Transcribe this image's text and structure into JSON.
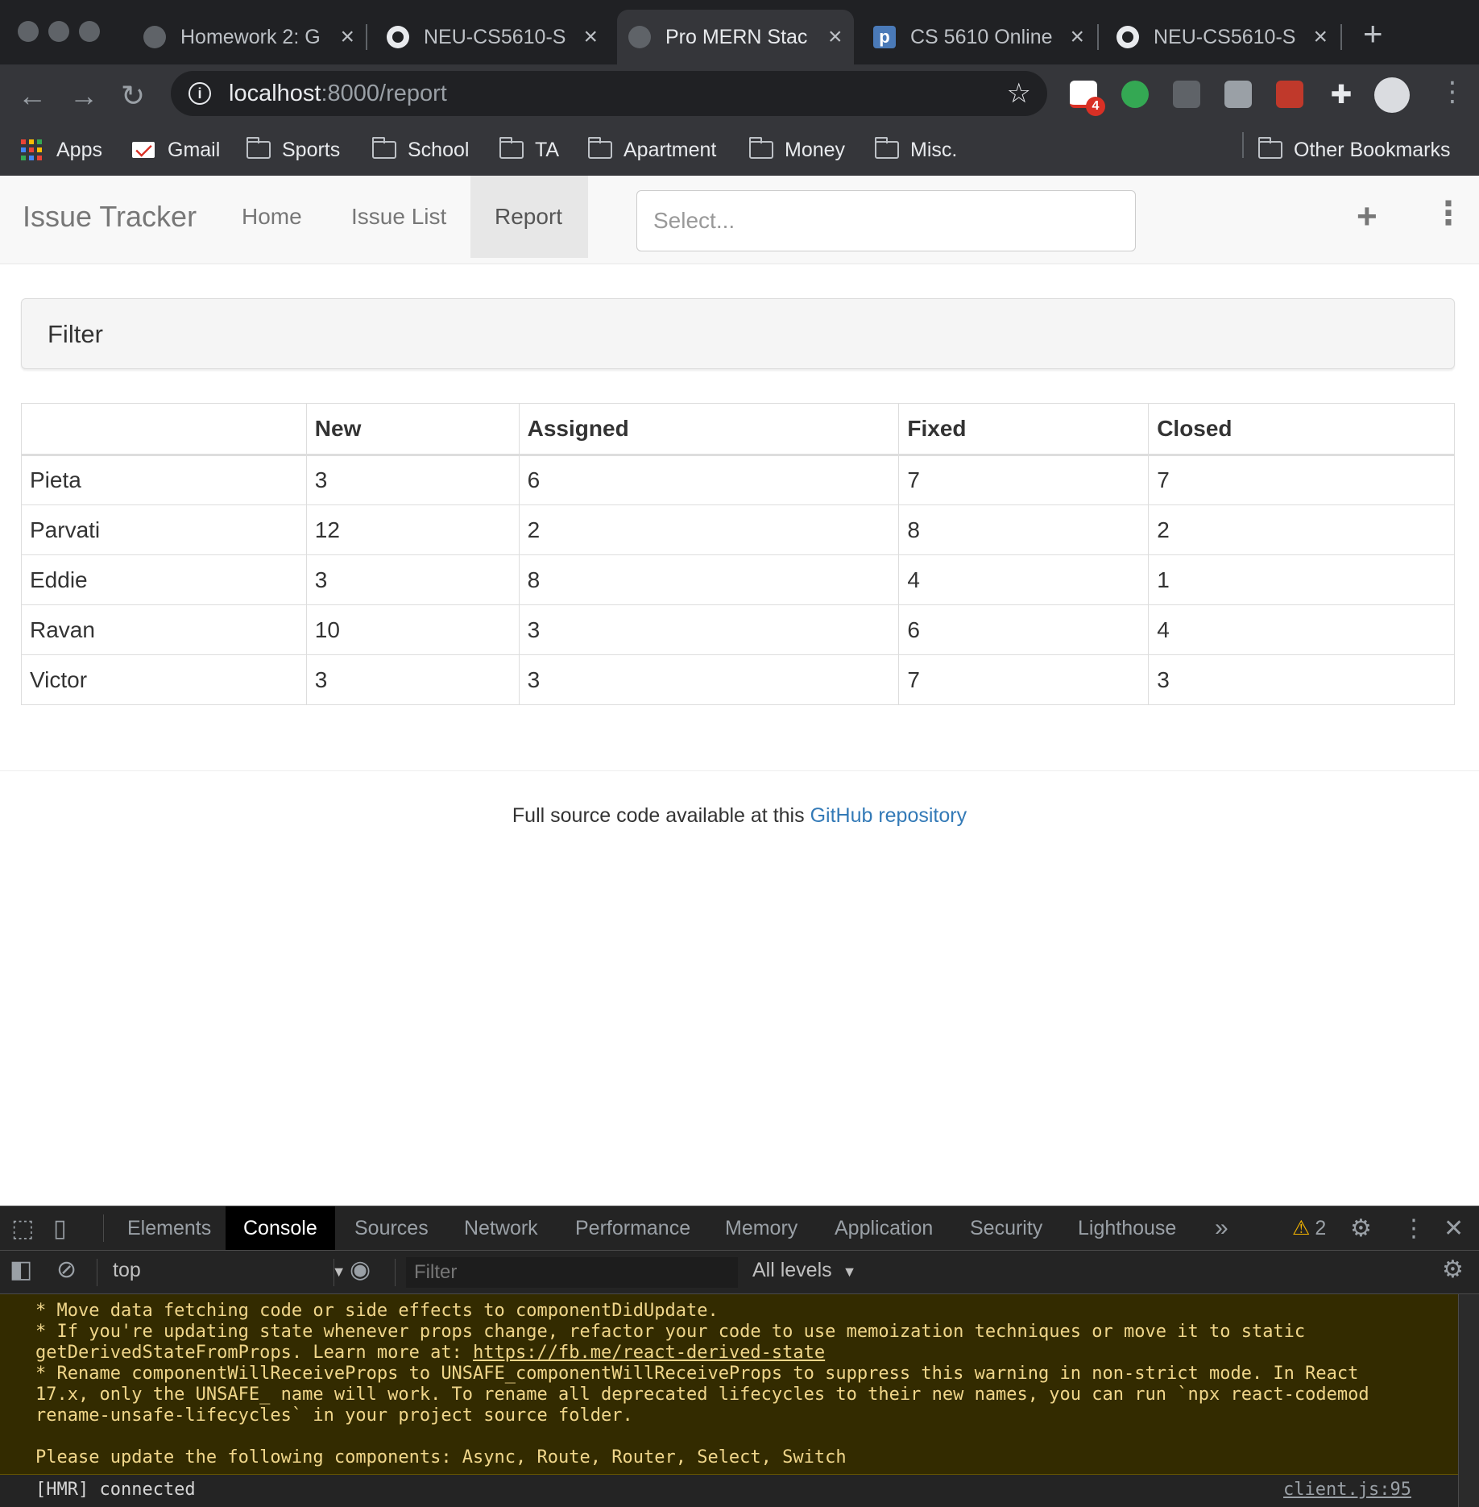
{
  "browser": {
    "tabs": [
      {
        "title": "Homework 2: G",
        "icon": "globe-icon"
      },
      {
        "title": "NEU-CS5610-S",
        "icon": "github-icon"
      },
      {
        "title": "Pro MERN Stac",
        "icon": "globe-icon",
        "active": true
      },
      {
        "title": "CS 5610 Online",
        "icon": "p-icon"
      },
      {
        "title": "NEU-CS5610-S",
        "icon": "github-icon"
      }
    ],
    "url_host": "localhost",
    "url_path": ":8000/report",
    "extension_badge": "4",
    "bookmarks": {
      "apps": "Apps",
      "gmail": "Gmail",
      "folders": [
        "Sports",
        "School",
        "TA",
        "Apartment",
        "Money",
        "Misc."
      ],
      "other": "Other Bookmarks"
    }
  },
  "app": {
    "brand": "Issue Tracker",
    "nav": {
      "home": "Home",
      "issue_list": "Issue List",
      "report": "Report"
    },
    "search_placeholder": "Select...",
    "filter_title": "Filter",
    "table": {
      "headers": [
        "",
        "New",
        "Assigned",
        "Fixed",
        "Closed"
      ],
      "rows": [
        [
          "Pieta",
          "3",
          "6",
          "7",
          "7"
        ],
        [
          "Parvati",
          "12",
          "2",
          "8",
          "2"
        ],
        [
          "Eddie",
          "3",
          "8",
          "4",
          "1"
        ],
        [
          "Ravan",
          "10",
          "3",
          "6",
          "4"
        ],
        [
          "Victor",
          "3",
          "3",
          "7",
          "3"
        ]
      ]
    },
    "footer_text": "Full source code available at this ",
    "footer_link": "GitHub repository"
  },
  "devtools": {
    "tabs": [
      "Elements",
      "Console",
      "Sources",
      "Network",
      "Performance",
      "Memory",
      "Application",
      "Security",
      "Lighthouse"
    ],
    "more": "»",
    "warning_count": "2",
    "context": "top",
    "filter_placeholder": "Filter",
    "levels": "All levels",
    "warning_lines": {
      "l1": "* Move data fetching code or side effects to componentDidUpdate.",
      "l2": "* If you're updating state whenever props change, refactor your code to use memoization techniques or move it to static",
      "l3a": "getDerivedStateFromProps. Learn more at: ",
      "l3link": "https://fb.me/react-derived-state",
      "l4": "* Rename componentWillReceiveProps to UNSAFE_componentWillReceiveProps to suppress this warning in non-strict mode. In React",
      "l5": "17.x, only the UNSAFE_ name will work. To rename all deprecated lifecycles to their new names, you can run `npx react-codemod",
      "l6": "rename-unsafe-lifecycles` in your project source folder.",
      "l8": "Please update the following components: Async, Route, Router, Select, Switch"
    },
    "log_line": "[HMR] connected",
    "log_source": "client.js:95"
  }
}
